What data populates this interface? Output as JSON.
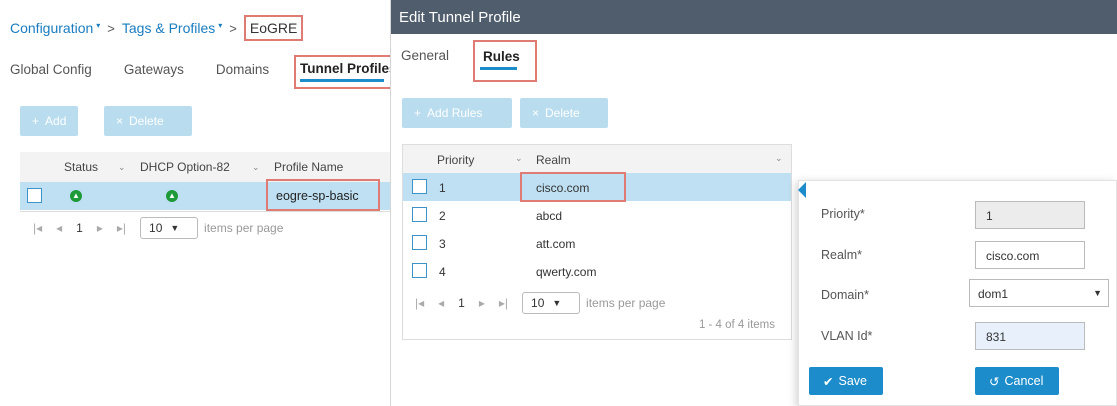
{
  "breadcrumb": {
    "configuration": "Configuration",
    "tags_profiles": "Tags & Profiles",
    "current": "EoGRE",
    "separator": ">",
    "caret": "▾"
  },
  "left_tabs": [
    "Global Config",
    "Gateways",
    "Domains",
    "Tunnel Profiles"
  ],
  "left_toolbar": {
    "add": "Add",
    "delete": "Delete"
  },
  "left_table": {
    "headers": [
      "Status",
      "DHCP Option-82",
      "Profile Name"
    ],
    "rows": [
      {
        "status": "up",
        "dhcp": "up",
        "profile_name": "eogre-sp-basic"
      }
    ]
  },
  "left_pager": {
    "page": "1",
    "per_page": "10",
    "per_page_label": "items per page"
  },
  "right_panel": {
    "title": "Edit Tunnel Profile",
    "tabs": [
      "General",
      "Rules"
    ],
    "toolbar": {
      "add": "Add Rules",
      "delete": "Delete"
    }
  },
  "rules_table": {
    "headers": [
      "Priority",
      "Realm"
    ],
    "rows": [
      {
        "priority": "1",
        "realm": "cisco.com",
        "selected": true
      },
      {
        "priority": "2",
        "realm": "abcd",
        "selected": false
      },
      {
        "priority": "3",
        "realm": "att.com",
        "selected": false
      },
      {
        "priority": "4",
        "realm": "qwerty.com",
        "selected": false
      }
    ],
    "pager": {
      "page": "1",
      "per_page": "10",
      "per_page_label": "items per page",
      "summary": "1 - 4 of 4 items"
    }
  },
  "rule_form": {
    "priority_label": "Priority*",
    "priority_value": "1",
    "realm_label": "Realm*",
    "realm_value": "cisco.com",
    "domain_label": "Domain*",
    "domain_value": "dom1",
    "vlan_label": "VLAN Id*",
    "vlan_value": "831",
    "save_label": "Save",
    "cancel_label": "Cancel"
  },
  "colors": {
    "accent": "#1c8dca",
    "header_bg": "#4f5d6c",
    "selected_row": "#bfe0f2",
    "highlight_box": "#e07b74",
    "status_up": "#1e9a3a"
  }
}
